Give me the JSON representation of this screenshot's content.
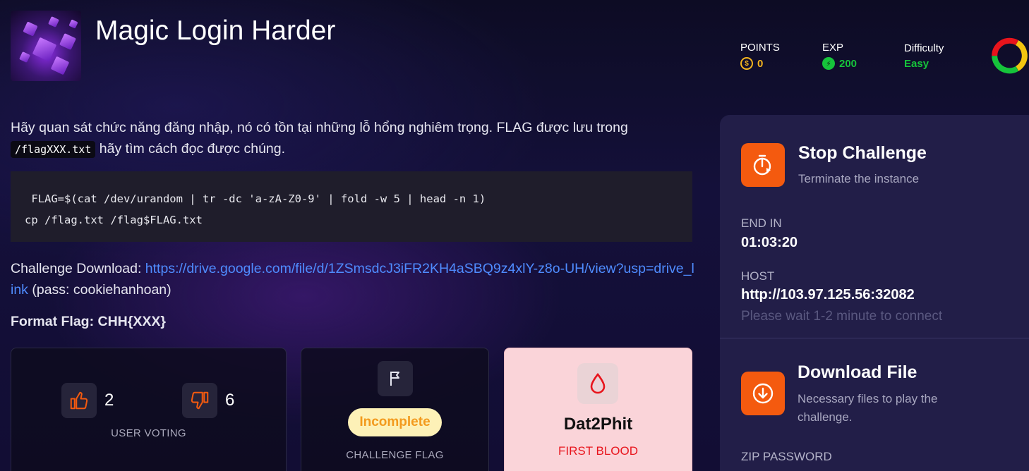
{
  "header": {
    "title": "Magic Login Harder",
    "thumbnail_alt": "challenge-thumbnail"
  },
  "stats": {
    "points": {
      "label": "POINTS",
      "value": "0"
    },
    "exp": {
      "label": "EXP",
      "value": "200"
    },
    "difficulty": {
      "label": "Difficulty",
      "value": "Easy"
    },
    "colors": {
      "points": "#f5b51e",
      "exp": "#16c43b",
      "easy": "#16c43b",
      "ring_red": "#e8141c",
      "ring_yellow": "#f3c510",
      "ring_green": "#16c43b"
    }
  },
  "description": {
    "text_before": "Hãy quan sát chức năng đăng nhập, nó có tồn tại những lỗ hổng nghiêm trọng. FLAG được lưu trong",
    "code": "/flagXXX.txt",
    "text_after": "hãy tìm cách đọc được chúng.",
    "code_block_line1": " FLAG=$(cat /dev/urandom | tr -dc 'a-zA-Z0-9' | fold -w 5 | head -n 1)",
    "code_block_line2": "cp /flag.txt /flag$FLAG.txt",
    "download_label": "Challenge Download: ",
    "download_link": "https://drive.google.com/file/d/1ZSmsdcJ3iFR2KH4aSBQ9z4xlY-z8o-UH/view?usp=drive_link",
    "download_pass": " (pass: cookiehanhoan)",
    "format_flag": "Format Flag: CHH{XXX}"
  },
  "voting": {
    "up_count": "2",
    "down_count": "6",
    "label": "USER VOTING"
  },
  "flag_card": {
    "status": "Incomplete",
    "label": "CHALLENGE FLAG"
  },
  "blood_card": {
    "user": "Dat2Phit",
    "label": "FIRST BLOOD"
  },
  "panel": {
    "stop": {
      "title": "Stop Challenge",
      "subtitle": "Terminate the instance"
    },
    "end_in": {
      "label": "END IN",
      "value": "01:03:20"
    },
    "host": {
      "label": "HOST",
      "value": "http://103.97.125.56:32082",
      "hint": "Please wait 1-2 minute to connect"
    },
    "download": {
      "title": "Download File",
      "subtitle": "Necessary files to play the challenge."
    },
    "zip": {
      "label": "ZIP PASSWORD"
    }
  }
}
